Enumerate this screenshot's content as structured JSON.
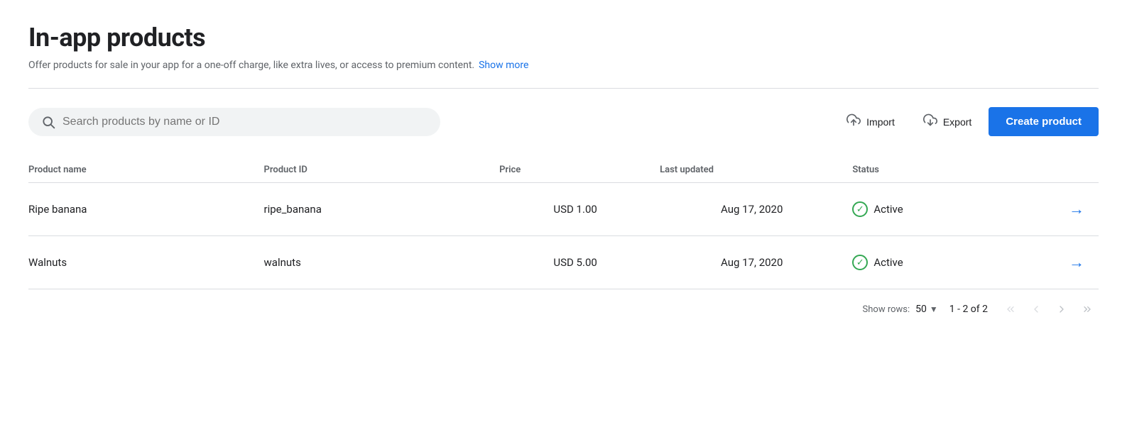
{
  "page": {
    "title": "In-app products",
    "subtitle": "Offer products for sale in your app for a one-off charge, like extra lives, or access to premium content.",
    "show_more": "Show more"
  },
  "toolbar": {
    "search_placeholder": "Search products by name or ID",
    "import_label": "Import",
    "export_label": "Export",
    "create_label": "Create product"
  },
  "table": {
    "columns": [
      {
        "key": "name",
        "label": "Product name"
      },
      {
        "key": "id",
        "label": "Product ID"
      },
      {
        "key": "price",
        "label": "Price"
      },
      {
        "key": "updated",
        "label": "Last updated"
      },
      {
        "key": "status",
        "label": "Status"
      },
      {
        "key": "arrow",
        "label": ""
      }
    ],
    "rows": [
      {
        "name": "Ripe banana",
        "product_id": "ripe_banana",
        "price": "USD 1.00",
        "last_updated": "Aug 17, 2020",
        "status": "Active"
      },
      {
        "name": "Walnuts",
        "product_id": "walnuts",
        "price": "USD 5.00",
        "last_updated": "Aug 17, 2020",
        "status": "Active"
      }
    ]
  },
  "pagination": {
    "show_rows_label": "Show rows:",
    "rows_count": "50",
    "page_info": "1 - 2 of 2"
  }
}
